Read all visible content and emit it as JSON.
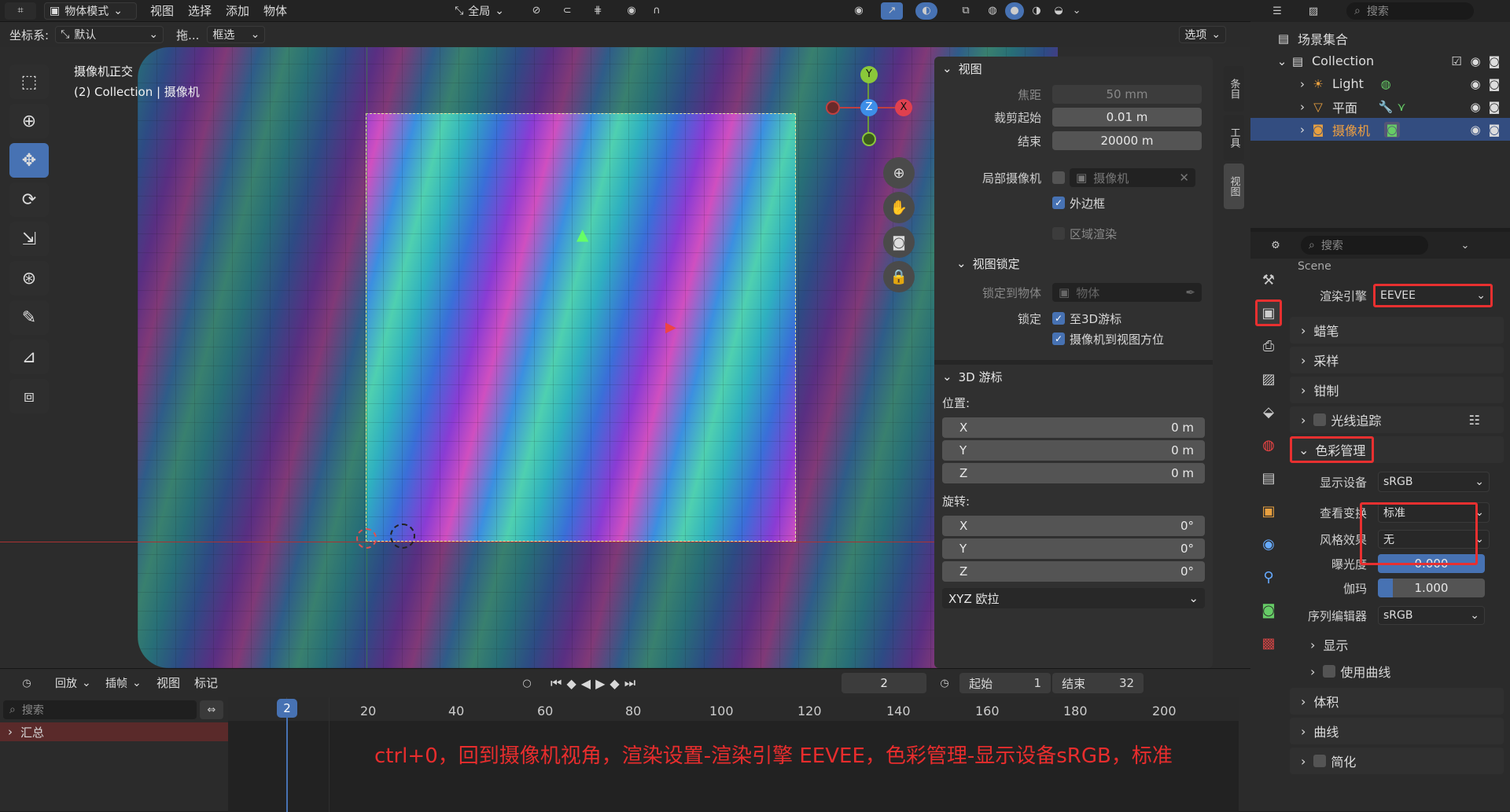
{
  "topbar": {
    "mode": "物体模式",
    "menus": [
      "视图",
      "选择",
      "添加",
      "物体"
    ],
    "transform_orient": "全局"
  },
  "toolheader": {
    "coord_label": "坐标系:",
    "coord_value": "默认",
    "drag_label": "拖...",
    "select_mode": "框选",
    "options": "选项"
  },
  "viewport": {
    "view_name": "摄像机正交",
    "collection_info": "(2) Collection | 摄像机",
    "gizmo": {
      "x": "X",
      "y": "Y",
      "z": "Z"
    }
  },
  "npanel": {
    "tabs": [
      "条目",
      "工具",
      "视图"
    ],
    "view_panel": {
      "title": "视图",
      "focal_label": "焦距",
      "focal_value": "50 mm",
      "clip_start_label": "裁剪起始",
      "clip_start_value": "0.01 m",
      "clip_end_label": "结束",
      "clip_end_value": "20000 m",
      "local_camera_label": "局部摄像机",
      "local_camera_value": "摄像机",
      "border_label": "外边框",
      "region_render_label": "区域渲染",
      "lock_title": "视图锁定",
      "lock_object_label": "锁定到物体",
      "lock_object_placeholder": "物体",
      "lock_label": "锁定",
      "lock_cursor_label": "至3D游标",
      "lock_camera_label": "摄像机到视图方位"
    },
    "cursor_panel": {
      "title": "3D 游标",
      "location_label": "位置:",
      "location": [
        {
          "axis": "X",
          "value": "0 m"
        },
        {
          "axis": "Y",
          "value": "0 m"
        },
        {
          "axis": "Z",
          "value": "0 m"
        }
      ],
      "rotation_label": "旋转:",
      "rotation": [
        {
          "axis": "X",
          "value": "0°"
        },
        {
          "axis": "Y",
          "value": "0°"
        },
        {
          "axis": "Z",
          "value": "0°"
        }
      ],
      "rotation_mode": "XYZ 欧拉"
    }
  },
  "outliner": {
    "search_placeholder": "搜索",
    "scene_collection": "场景集合",
    "items": [
      {
        "name": "Collection"
      },
      {
        "name": "Light"
      },
      {
        "name": "平面"
      },
      {
        "name": "摄像机"
      }
    ]
  },
  "properties": {
    "search_placeholder": "搜索",
    "scene_label": "Scene",
    "render_engine_label": "渲染引擎",
    "render_engine_value": "EEVEE",
    "sections_top": [
      "蜡笔",
      "采样",
      "钳制",
      "光线追踪"
    ],
    "color_mgmt_title": "色彩管理",
    "display_device_label": "显示设备",
    "display_device_value": "sRGB",
    "view_transform_label": "查看变换",
    "view_transform_value": "标准",
    "look_label": "风格效果",
    "look_value": "无",
    "exposure_label": "曝光度",
    "exposure_value": "0.000",
    "gamma_label": "伽玛",
    "gamma_value": "1.000",
    "sequencer_label": "序列编辑器",
    "sequencer_value": "sRGB",
    "display_sub": "显示",
    "curves_sub": "使用曲线",
    "sections_bottom": [
      "体积",
      "曲线",
      "简化"
    ]
  },
  "timeline": {
    "menus": [
      "回放",
      "插帧",
      "视图",
      "标记"
    ],
    "current_frame": "2",
    "start_label": "起始",
    "start_value": "1",
    "end_label": "结束",
    "end_value": "32",
    "search_placeholder": "搜索",
    "summary": "汇总",
    "ticks": [
      "20",
      "40",
      "60",
      "80",
      "100",
      "120",
      "140",
      "160",
      "180",
      "200"
    ],
    "playhead": "2"
  },
  "caption": "ctrl+0，回到摄像机视角，渲染设置-渲染引擎 EEVEE，色彩管理-显示设备sRGB，标准",
  "colors": {
    "accent": "#4772b3",
    "highlight_box": "#e83030",
    "caption": "#e82d2d"
  }
}
